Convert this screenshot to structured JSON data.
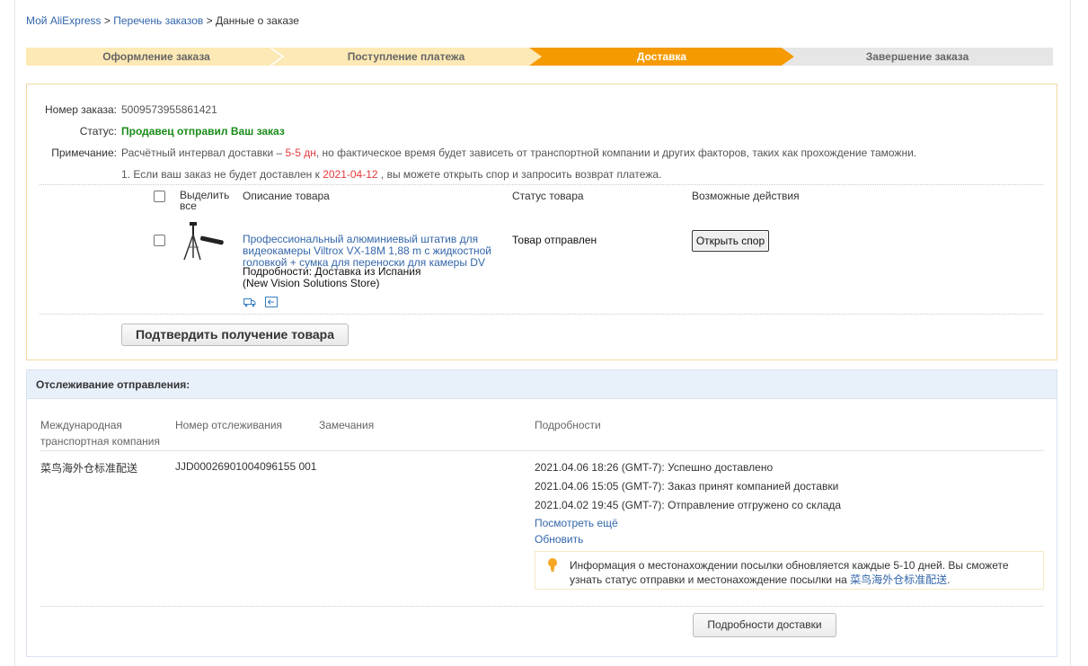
{
  "breadcrumb": {
    "home": "Мой AliExpress",
    "sep": ">",
    "orders": "Перечень заказов",
    "current": "Данные о заказе"
  },
  "steps": [
    {
      "label": "Оформление заказа",
      "state": "done"
    },
    {
      "label": "Поступление платежа",
      "state": "done"
    },
    {
      "label": "Доставка",
      "state": "active"
    },
    {
      "label": "Завершение заказа",
      "state": "pending"
    }
  ],
  "colors": {
    "step_done": "#fde9b5",
    "step_active": "#f59a00",
    "step_pending": "#e6e6e6",
    "link": "#3366aa",
    "success": "#1a8c1a",
    "alert": "#e4393c"
  },
  "order": {
    "number_label": "Номер заказа:",
    "number_value": "5009573955861421",
    "status_label": "Статус:",
    "status_value": "Продавец отправил Ваш заказ",
    "note_label": "Примечание:",
    "note_prefix": "Расчётный интервал доставки –",
    "note_interval": "5-5 дн",
    "note_suffix": ", но фактическое время будет зависеть от транспортной компании и других факторов, таких как прохождение таможни.",
    "dispute_prefix": "1. Если ваш заказ не будет доставлен к",
    "dispute_date": "2021-04-12",
    "dispute_suffix": ", вы можете открыть спор и запросить возврат платежа."
  },
  "items_table": {
    "select_all": "Выделить все",
    "col_description": "Описание товара",
    "col_status": "Статус товара",
    "col_actions": "Возможные действия"
  },
  "item": {
    "title": "Профессиональный алюминиевый штатив для видеокамеры Viltrox VX-18M 1,88 m с жидкостной головкой + сумка для переноски для камеры DV",
    "details": "Подробности: Доставка из Испания",
    "store": "(New Vision Solutions Store)",
    "status": "Товар отправлен",
    "action": "Открыть спор",
    "icons": [
      "shipping-truck-icon",
      "return-icon"
    ]
  },
  "confirm_button": "Подтвердить получение товара",
  "tracking": {
    "title": "Отслеживание отправления:",
    "col_company": "Международная транспортная компания",
    "col_number": "Номер отслеживания",
    "col_remarks": "Замечания",
    "col_details": "Подробности",
    "company": "菜鸟海外仓标准配送",
    "number": "JJD00026901004096155 001",
    "events": [
      "2021.04.06 18:26 (GMT-7): Успешно доставлено",
      "2021.04.06 15:05 (GMT-7): Заказ принят компанией доставки",
      "2021.04.02 19:45 (GMT-7): Отправление отгружено со склада"
    ],
    "see_more": "Посмотреть ещё",
    "refresh": "Обновить",
    "notice_text": "Информация о местонахождении посылки обновляется каждые 5-10 дней. Вы сможете узнать статус отправки и местонахождение посылки на",
    "notice_link": "菜鸟海外仓标准配送",
    "notice_end": ".",
    "delivery_button": "Подробности доставки"
  }
}
